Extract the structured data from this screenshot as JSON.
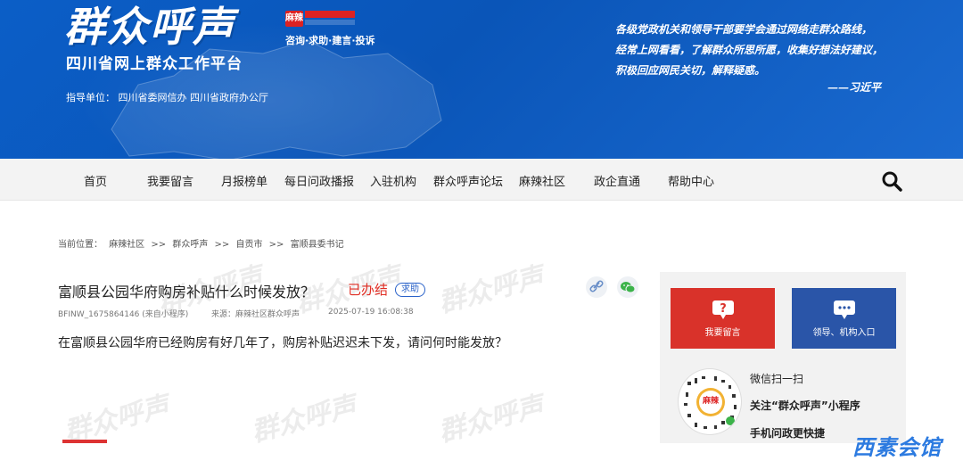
{
  "banner": {
    "logo_main": "群众呼声",
    "logo_sub": "四川省网上群众工作平台",
    "mala_badge": "麻辣",
    "tags": "咨询·求助·建言·投诉",
    "guide": "指导单位：  四川省委网信办  四川省政府办公厅",
    "quote_lines": [
      "各级党政机关和领导干部要学会通过网络走群众路线，",
      "经常上网看看，了解群众所思所愿，收集好想法好建议，",
      "积极回应网民关切，解释疑惑。"
    ],
    "quote_author": "——习近平"
  },
  "nav": {
    "items": [
      "首页",
      "我要留言",
      "月报榜单",
      "每日问政播报",
      "入驻机构",
      "群众呼声论坛",
      "麻辣社区",
      "政企直通",
      "帮助中心"
    ]
  },
  "breadcrumb": [
    "当前位置：",
    "麻辣社区",
    ">>",
    "群众呼声",
    ">>",
    "自贡市",
    ">>",
    "富顺县委书记"
  ],
  "article": {
    "title": "富顺县公园华府购房补贴什么时候发放？",
    "status": "已办结",
    "tag": "求助",
    "meta_id": "BFINW_1675864146 (来自小程序)",
    "meta_source": "来源：麻辣社区群众呼声",
    "meta_time": "2025-07-19 16:08:38",
    "body": "在富顺县公园华府已经购房有好几年了，购房补贴迟迟未下发，请问何时能发放？"
  },
  "watermark": "群众呼声",
  "sidebar": {
    "btn_left": "我要留言",
    "btn_right": "领导、机构入口",
    "qr_badge": "麻辣",
    "qr_title": "微信扫一扫",
    "qr_line1": "关注“群众呼声”小程序",
    "qr_line2": "手机问政更快捷"
  },
  "corner_logo": "西素会馆",
  "colors": {
    "banner": "#0b5ec7",
    "status_red": "#e02e24",
    "tag_blue": "#2a62c9",
    "side_red": "#d9322a",
    "side_blue": "#2a55a8"
  }
}
